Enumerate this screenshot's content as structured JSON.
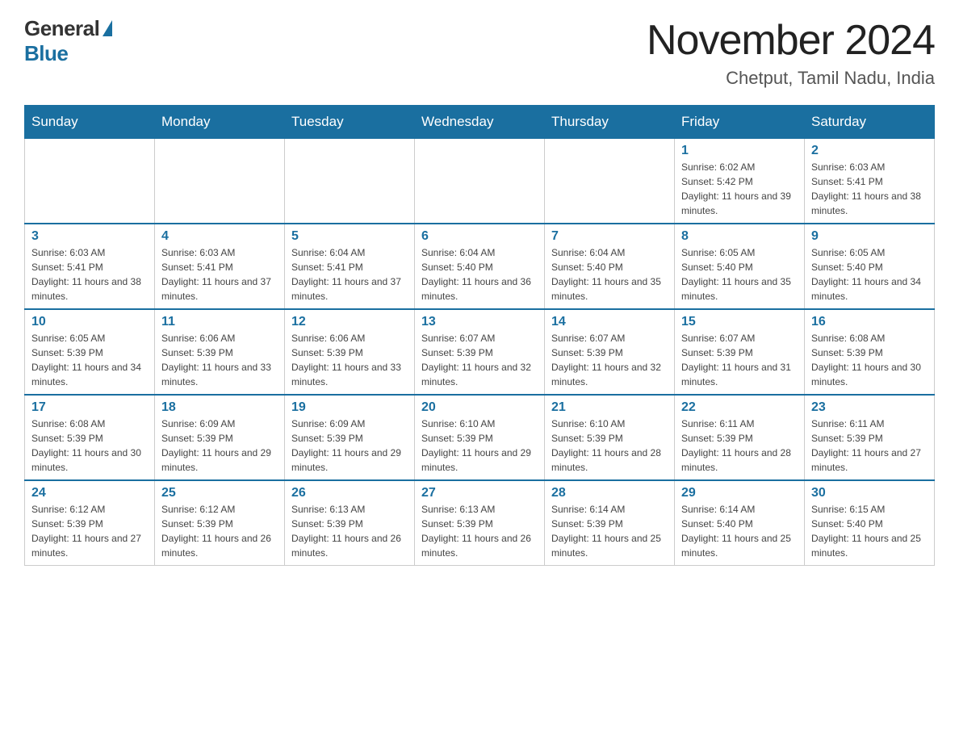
{
  "header": {
    "logo_general": "General",
    "logo_blue": "Blue",
    "month_title": "November 2024",
    "location": "Chetput, Tamil Nadu, India"
  },
  "days_of_week": [
    "Sunday",
    "Monday",
    "Tuesday",
    "Wednesday",
    "Thursday",
    "Friday",
    "Saturday"
  ],
  "weeks": [
    [
      {
        "day": "",
        "info": ""
      },
      {
        "day": "",
        "info": ""
      },
      {
        "day": "",
        "info": ""
      },
      {
        "day": "",
        "info": ""
      },
      {
        "day": "",
        "info": ""
      },
      {
        "day": "1",
        "info": "Sunrise: 6:02 AM\nSunset: 5:42 PM\nDaylight: 11 hours and 39 minutes."
      },
      {
        "day": "2",
        "info": "Sunrise: 6:03 AM\nSunset: 5:41 PM\nDaylight: 11 hours and 38 minutes."
      }
    ],
    [
      {
        "day": "3",
        "info": "Sunrise: 6:03 AM\nSunset: 5:41 PM\nDaylight: 11 hours and 38 minutes."
      },
      {
        "day": "4",
        "info": "Sunrise: 6:03 AM\nSunset: 5:41 PM\nDaylight: 11 hours and 37 minutes."
      },
      {
        "day": "5",
        "info": "Sunrise: 6:04 AM\nSunset: 5:41 PM\nDaylight: 11 hours and 37 minutes."
      },
      {
        "day": "6",
        "info": "Sunrise: 6:04 AM\nSunset: 5:40 PM\nDaylight: 11 hours and 36 minutes."
      },
      {
        "day": "7",
        "info": "Sunrise: 6:04 AM\nSunset: 5:40 PM\nDaylight: 11 hours and 35 minutes."
      },
      {
        "day": "8",
        "info": "Sunrise: 6:05 AM\nSunset: 5:40 PM\nDaylight: 11 hours and 35 minutes."
      },
      {
        "day": "9",
        "info": "Sunrise: 6:05 AM\nSunset: 5:40 PM\nDaylight: 11 hours and 34 minutes."
      }
    ],
    [
      {
        "day": "10",
        "info": "Sunrise: 6:05 AM\nSunset: 5:39 PM\nDaylight: 11 hours and 34 minutes."
      },
      {
        "day": "11",
        "info": "Sunrise: 6:06 AM\nSunset: 5:39 PM\nDaylight: 11 hours and 33 minutes."
      },
      {
        "day": "12",
        "info": "Sunrise: 6:06 AM\nSunset: 5:39 PM\nDaylight: 11 hours and 33 minutes."
      },
      {
        "day": "13",
        "info": "Sunrise: 6:07 AM\nSunset: 5:39 PM\nDaylight: 11 hours and 32 minutes."
      },
      {
        "day": "14",
        "info": "Sunrise: 6:07 AM\nSunset: 5:39 PM\nDaylight: 11 hours and 32 minutes."
      },
      {
        "day": "15",
        "info": "Sunrise: 6:07 AM\nSunset: 5:39 PM\nDaylight: 11 hours and 31 minutes."
      },
      {
        "day": "16",
        "info": "Sunrise: 6:08 AM\nSunset: 5:39 PM\nDaylight: 11 hours and 30 minutes."
      }
    ],
    [
      {
        "day": "17",
        "info": "Sunrise: 6:08 AM\nSunset: 5:39 PM\nDaylight: 11 hours and 30 minutes."
      },
      {
        "day": "18",
        "info": "Sunrise: 6:09 AM\nSunset: 5:39 PM\nDaylight: 11 hours and 29 minutes."
      },
      {
        "day": "19",
        "info": "Sunrise: 6:09 AM\nSunset: 5:39 PM\nDaylight: 11 hours and 29 minutes."
      },
      {
        "day": "20",
        "info": "Sunrise: 6:10 AM\nSunset: 5:39 PM\nDaylight: 11 hours and 29 minutes."
      },
      {
        "day": "21",
        "info": "Sunrise: 6:10 AM\nSunset: 5:39 PM\nDaylight: 11 hours and 28 minutes."
      },
      {
        "day": "22",
        "info": "Sunrise: 6:11 AM\nSunset: 5:39 PM\nDaylight: 11 hours and 28 minutes."
      },
      {
        "day": "23",
        "info": "Sunrise: 6:11 AM\nSunset: 5:39 PM\nDaylight: 11 hours and 27 minutes."
      }
    ],
    [
      {
        "day": "24",
        "info": "Sunrise: 6:12 AM\nSunset: 5:39 PM\nDaylight: 11 hours and 27 minutes."
      },
      {
        "day": "25",
        "info": "Sunrise: 6:12 AM\nSunset: 5:39 PM\nDaylight: 11 hours and 26 minutes."
      },
      {
        "day": "26",
        "info": "Sunrise: 6:13 AM\nSunset: 5:39 PM\nDaylight: 11 hours and 26 minutes."
      },
      {
        "day": "27",
        "info": "Sunrise: 6:13 AM\nSunset: 5:39 PM\nDaylight: 11 hours and 26 minutes."
      },
      {
        "day": "28",
        "info": "Sunrise: 6:14 AM\nSunset: 5:39 PM\nDaylight: 11 hours and 25 minutes."
      },
      {
        "day": "29",
        "info": "Sunrise: 6:14 AM\nSunset: 5:40 PM\nDaylight: 11 hours and 25 minutes."
      },
      {
        "day": "30",
        "info": "Sunrise: 6:15 AM\nSunset: 5:40 PM\nDaylight: 11 hours and 25 minutes."
      }
    ]
  ]
}
